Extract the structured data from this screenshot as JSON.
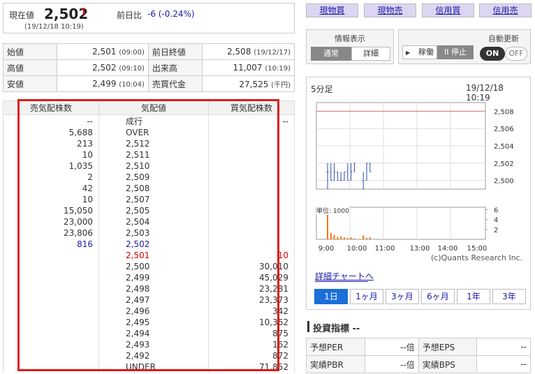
{
  "quote": {
    "label": "現在値",
    "price": "2,502",
    "arrow": "↑",
    "change_label": "前日比",
    "change": "-6 (-0.24%)",
    "time": "(19/12/18 10:19)"
  },
  "stats": [
    {
      "k1": "始値",
      "v1": "2,501",
      "t1": "(09:00)",
      "k2": "前日終値",
      "v2": "2,508",
      "t2": "(19/12/17)"
    },
    {
      "k1": "高値",
      "v1": "2,502",
      "t1": "(09:10)",
      "k2": "出来高",
      "v2": "11,007",
      "t2": "(10:19)"
    },
    {
      "k1": "安値",
      "v1": "2,499",
      "t1": "(10:04)",
      "k2": "売買代金",
      "v2": "27,525",
      "t2": "(千円)"
    }
  ],
  "book": {
    "headers": [
      "売気配株数",
      "気配値",
      "買気配株数"
    ],
    "rows": [
      [
        "--",
        "成行",
        "--"
      ],
      [
        "5,688",
        "OVER",
        ""
      ],
      [
        "213",
        "2,512",
        ""
      ],
      [
        "10",
        "2,511",
        ""
      ],
      [
        "1,035",
        "2,510",
        ""
      ],
      [
        "2",
        "2,509",
        ""
      ],
      [
        "42",
        "2,508",
        ""
      ],
      [
        "10",
        "2,507",
        ""
      ],
      [
        "15,050",
        "2,505",
        ""
      ],
      [
        "23,000",
        "2,504",
        ""
      ],
      [
        "23,806",
        "2,503",
        ""
      ],
      [
        "816",
        "2,502",
        ""
      ],
      [
        "",
        "2,501",
        "10"
      ],
      [
        "",
        "2,500",
        "30,010"
      ],
      [
        "",
        "2,499",
        "45,029"
      ],
      [
        "",
        "2,498",
        "23,281"
      ],
      [
        "",
        "2,497",
        "23,373"
      ],
      [
        "",
        "2,496",
        "342"
      ],
      [
        "",
        "2,495",
        "10,362"
      ],
      [
        "",
        "2,494",
        "875"
      ],
      [
        "",
        "2,493",
        "162"
      ],
      [
        "",
        "2,492",
        "872"
      ],
      [
        "",
        "UNDER",
        "71,852"
      ]
    ],
    "best_ask_color": "#1a1aa6",
    "best_bid_color": "#d40000"
  },
  "trade_buttons": [
    "現物買",
    "現物売",
    "信用買",
    "信用売"
  ],
  "info_panel": {
    "title": "情報表示",
    "normal": "通常",
    "detail": "詳細"
  },
  "auto_panel": {
    "title": "自動更新",
    "run": "稼働",
    "stop": "II 停止",
    "on": "ON",
    "off": "OFF"
  },
  "chart": {
    "interval": "5分足",
    "datetime": "19/12/18 10:19",
    "copyright": "(c)Quants Research Inc.",
    "price_ticks": [
      "2,508",
      "2,506",
      "2,504",
      "2,502",
      "2,500"
    ],
    "volume_unit": "単位: 1000",
    "volume_ticks": [
      "6",
      "4",
      "2"
    ],
    "time_ticks": [
      "9:00",
      "10:00",
      "11:00",
      "13:00",
      "14:00",
      "15:00"
    ],
    "detail_link": "詳細チャートへ"
  },
  "chart_data": {
    "type": "line",
    "title": "5分足",
    "ylim": [
      2499,
      2509
    ],
    "prev_close": 2508,
    "bars": [
      {
        "t": "9:00",
        "o": 2501,
        "h": 2502,
        "l": 2499,
        "c": 2501
      },
      {
        "t": "9:05",
        "o": 2501,
        "h": 2502,
        "l": 2500,
        "c": 2500
      },
      {
        "t": "9:10",
        "o": 2500,
        "h": 2502,
        "l": 2500,
        "c": 2501
      },
      {
        "t": "9:15",
        "o": 2501,
        "h": 2501,
        "l": 2500,
        "c": 2500
      },
      {
        "t": "9:20",
        "o": 2500,
        "h": 2501,
        "l": 2500,
        "c": 2500
      },
      {
        "t": "9:25",
        "o": 2500,
        "h": 2501,
        "l": 2500,
        "c": 2501
      },
      {
        "t": "9:30",
        "o": 2501,
        "h": 2502,
        "l": 2500,
        "c": 2500
      },
      {
        "t": "9:35",
        "o": 2500,
        "h": 2502,
        "l": 2500,
        "c": 2501
      },
      {
        "t": "9:40",
        "o": 2501,
        "h": 2502,
        "l": 2501,
        "c": 2502
      },
      {
        "t": "10:00",
        "o": 2500,
        "h": 2501,
        "l": 2499,
        "c": 2499
      },
      {
        "t": "10:05",
        "o": 2500,
        "h": 2502,
        "l": 2500,
        "c": 2502
      },
      {
        "t": "10:15",
        "o": 2502,
        "h": 2502,
        "l": 2501,
        "c": 2501
      }
    ],
    "volume": [
      6.2,
      1.3,
      0.9,
      0.5,
      0.6,
      0.4,
      0.3,
      0.4,
      0.2,
      0.8,
      0.3,
      0.4
    ]
  },
  "periods": [
    "1日",
    "1ヶ月",
    "3ヶ月",
    "6ヶ月",
    "1年",
    "3年"
  ],
  "indicators": {
    "title": "投資指標 --",
    "rows": [
      {
        "k1": "予想PER",
        "v1": "--倍",
        "k2": "予想EPS",
        "v2": "--"
      },
      {
        "k1": "実績PBR",
        "v1": "--倍",
        "k2": "実績BPS",
        "v2": "--"
      }
    ]
  }
}
